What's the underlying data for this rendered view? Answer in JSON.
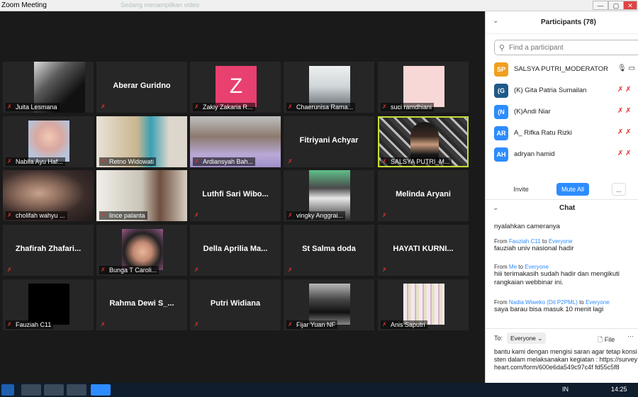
{
  "window": {
    "title": "Zoom Meeting",
    "faded_label": "Sedang menampilkan video"
  },
  "colors": {
    "active_speaker": "#c8dc38",
    "mute_red": "#e0322b",
    "accent": "#2d8cff",
    "avatar_z": "#e8406f"
  },
  "tiles": [
    {
      "name": "Juita Lesmana",
      "display": "",
      "kind": "video"
    },
    {
      "name": "",
      "display": "Aberar Guridno",
      "kind": "text"
    },
    {
      "name": "Zakiy Zakaria R...",
      "display": "Z",
      "kind": "avatar"
    },
    {
      "name": "Chaerunisa Rama...",
      "display": "",
      "kind": "video"
    },
    {
      "name": "suci ramdhiani",
      "display": "",
      "kind": "video"
    },
    {
      "name": "Nabila Ayu Haf...",
      "display": "",
      "kind": "video"
    },
    {
      "name": "Retno Widowati",
      "display": "",
      "kind": "video"
    },
    {
      "name": "Ardiansyah Bah...",
      "display": "",
      "kind": "video"
    },
    {
      "name": "",
      "display": "Fitriyani Achyar",
      "kind": "text"
    },
    {
      "name": "SALSYA PUTRI_M...",
      "display": "",
      "kind": "video",
      "active": true
    },
    {
      "name": "cholifah wahyu ...",
      "display": "",
      "kind": "video"
    },
    {
      "name": "lince palanta",
      "display": "",
      "kind": "video"
    },
    {
      "name": "",
      "display": "Luthfi Sari Wibo...",
      "kind": "text"
    },
    {
      "name": "vingky Anggrai...",
      "display": "",
      "kind": "video"
    },
    {
      "name": "",
      "display": "Melinda Aryani",
      "kind": "text"
    },
    {
      "name": "",
      "display": "Zhafirah Zhafari...",
      "kind": "text"
    },
    {
      "name": "Bunga T Caroli...",
      "display": "",
      "kind": "video"
    },
    {
      "name": "",
      "display": "Della Aprilia Ma...",
      "kind": "text"
    },
    {
      "name": "",
      "display": "St Salma doda",
      "kind": "text"
    },
    {
      "name": "",
      "display": "HAYATI KURNI...",
      "kind": "text"
    },
    {
      "name": "Fauziah C11",
      "display": "",
      "kind": "video"
    },
    {
      "name": "",
      "display": "Rahma Dewi S_...",
      "kind": "text"
    },
    {
      "name": "",
      "display": "Putri Widiana",
      "kind": "text"
    },
    {
      "name": "Fijar Yuan NF",
      "display": "",
      "kind": "video"
    },
    {
      "name": "Anis Saputri",
      "display": "",
      "kind": "video"
    }
  ],
  "participants": {
    "title": "Participants (78)",
    "search_placeholder": "Find a participant",
    "list": [
      {
        "initials": "SP",
        "name": "SALSYA PUTRI_MODERATOR",
        "color": "#f0a020"
      },
      {
        "initials": "(G",
        "name": "(K) Gita Patria Sumailan",
        "color": "#1f5a8a"
      },
      {
        "initials": "(N",
        "name": "(K)Andi Niar",
        "color": "#2d8cff"
      },
      {
        "initials": "AR",
        "name": "A_ Rifka Ratu Rizki",
        "color": "#2d8cff"
      },
      {
        "initials": "AH",
        "name": "adryan hamid",
        "color": "#2d8cff"
      }
    ],
    "invite": "Invite",
    "mute_all": "Mute All",
    "more": "..."
  },
  "chat": {
    "title": "Chat",
    "messages": [
      {
        "from": "",
        "to": "",
        "text": "nyalahkan cameranya"
      },
      {
        "from": "Fauziah C11",
        "to": "Everyone",
        "text": "fauziah univ nasional hadir"
      },
      {
        "from": "Me",
        "to": "Everyone",
        "text": "hiii terimakasih sudah hadir dan mengikuti rangkaian webbinar ini."
      },
      {
        "from": "Nadia Wiweko (Dit P2PML)",
        "to": "Everyone",
        "text": "saya barau bisa masuk 10 menit lagi"
      }
    ],
    "from_word": "From",
    "to_word": "to",
    "to_label": "To:",
    "target": "Everyone",
    "file": "File",
    "input_text": "bantu kami dengan mengisi saran agar tetap konsisten dalam melaksanakan kegiatan : https://surveyheart.com/form/600e6da549c97c4f fd55c5f8"
  },
  "taskbar": {
    "lang": "IN",
    "time": "14:25"
  }
}
